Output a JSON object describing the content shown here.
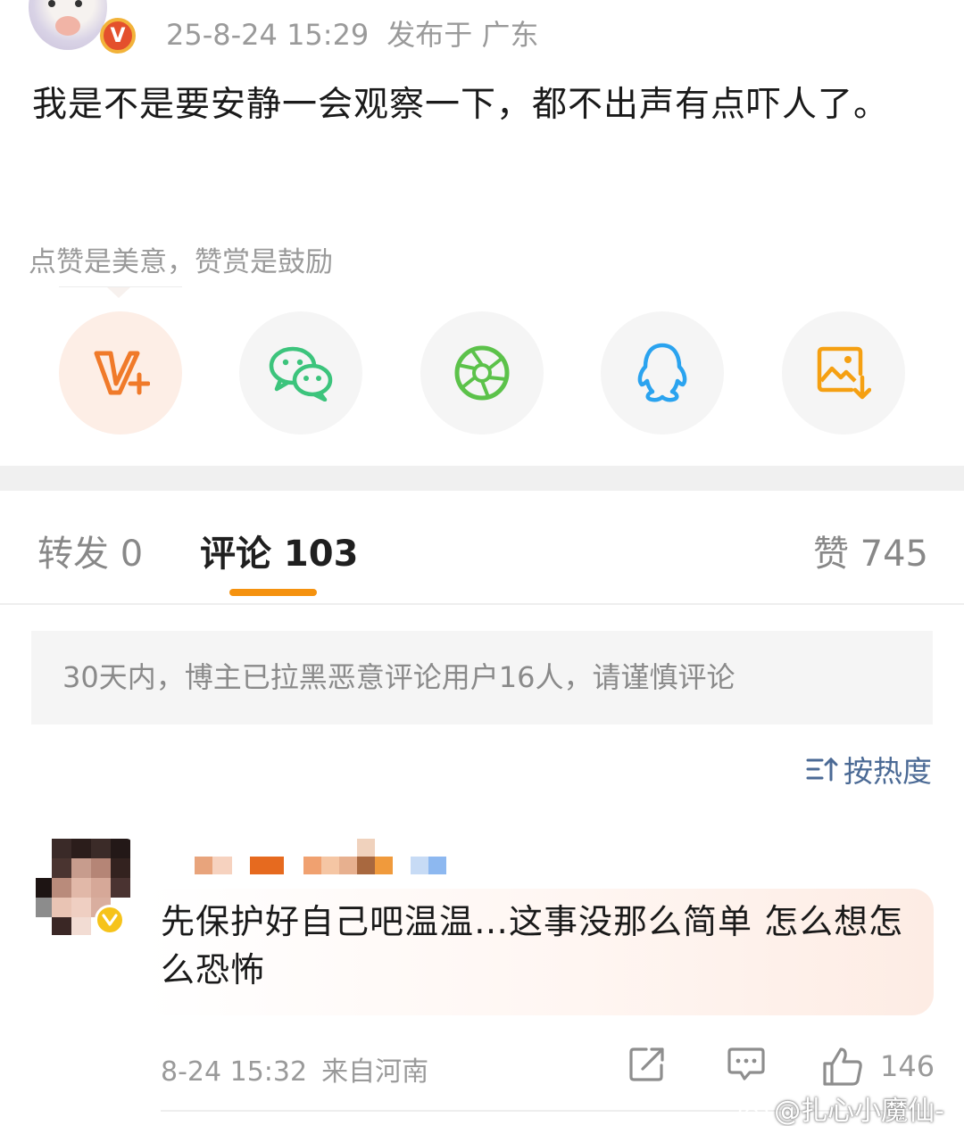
{
  "post": {
    "date_time": "25-8-24 15:29",
    "location": "发布于 广东",
    "text": "我是不是要安静一会观察一下，都不出声有点吓人了。",
    "verified_badge": "V"
  },
  "reward_hint": "点赞是美意，赞赏是鼓励",
  "share_buttons": [
    {
      "icon": "reward-icon",
      "color": "#f07a2a"
    },
    {
      "icon": "wechat-icon",
      "color": "#3cc47c"
    },
    {
      "icon": "moments-icon",
      "color": "#5cc24a"
    },
    {
      "icon": "qq-icon",
      "color": "#2aa3ef"
    },
    {
      "icon": "save-image-icon",
      "color": "#f5a012"
    }
  ],
  "tabs": {
    "repost": "转发 0",
    "comment": "评论 103",
    "like": "赞 745",
    "active_color": "#f5920f"
  },
  "notice": "30天内，博主已拉黑恶意评论用户16人，请谨慎评论",
  "sort": {
    "label": "按热度",
    "color": "#4b6a95"
  },
  "comment": {
    "text": "先保护好自己吧温温…这事没那么简单 怎么想怎么恐怖",
    "date_time": "8-24 15:32",
    "location": "来自河南",
    "like_count": "146"
  },
  "watermark": "@扎心小魔仙-"
}
